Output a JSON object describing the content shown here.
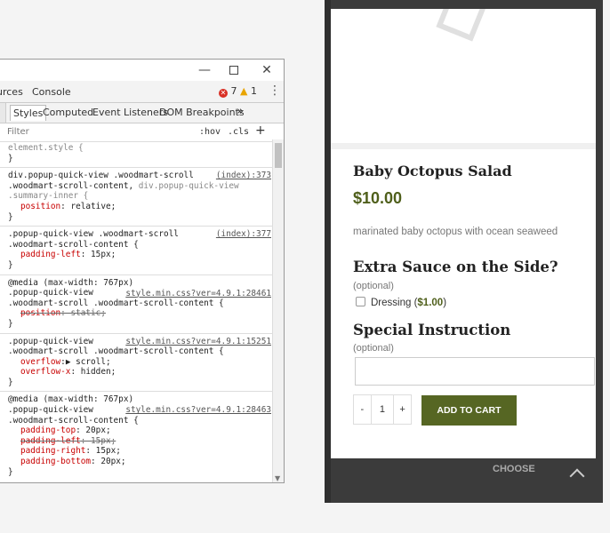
{
  "devtools": {
    "tabs": {
      "sources_partial": "urces",
      "console": "Console"
    },
    "errors": {
      "error_count": "7",
      "warning_count": "1"
    },
    "subtabs": {
      "styles": "Styles",
      "computed": "Computed",
      "event_listeners": "Event Listeners",
      "dom_breakpoints": "DOM Breakpoints",
      "more": "»"
    },
    "filter": {
      "placeholder": "Filter",
      "hov": ":hov",
      "cls": ".cls",
      "add": "+"
    },
    "rules": [
      {
        "sel1": "element.style {",
        "close": "}"
      },
      {
        "sel1": "div.popup-quick-view .woodmart-scroll",
        "sel2": ".woodmart-scroll-content,",
        "sel2b": "div.popup-quick-view",
        "sel3": ".summary-inner {",
        "source": "(index):373",
        "decls": [
          {
            "prop": "position",
            "val": "relative;"
          }
        ],
        "close": "}"
      },
      {
        "sel1": ".popup-quick-view .woodmart-scroll",
        "sel2": ".woodmart-scroll-content {",
        "source": "(index):377",
        "decls": [
          {
            "prop": "padding-left",
            "val": "15px;"
          }
        ],
        "close": "}"
      },
      {
        "media": "@media (max-width: 767px)",
        "sel1": ".popup-quick-view",
        "sel2": ".woodmart-scroll .woodmart-scroll-content {",
        "source": "style.min.css?ver=4.9.1:28461",
        "decls": [
          {
            "prop": "position",
            "val": "static;",
            "struck": true
          }
        ],
        "close": "}"
      },
      {
        "sel1": ".popup-quick-view",
        "sel2": ".woodmart-scroll .woodmart-scroll-content {",
        "source": "style.min.css?ver=4.9.1:15251",
        "decls": [
          {
            "prop": "overflow",
            "val": "▶ scroll;"
          },
          {
            "prop": "overflow-x",
            "val": "hidden;"
          }
        ],
        "close": "}"
      },
      {
        "media": "@media (max-width: 767px)",
        "sel1": ".popup-quick-view",
        "sel2": ".woodmart-scroll",
        "sel3": ".woodmart-scroll-content {",
        "source": "style.min.css?ver=4.9.1:28463",
        "decls": [
          {
            "prop": "padding-top",
            "val": "20px;"
          },
          {
            "prop": "padding-left",
            "val": "15px;",
            "struck": true
          },
          {
            "prop": "padding-right",
            "val": "15px;"
          },
          {
            "prop": "padding-bottom",
            "val": "20px;"
          }
        ],
        "close": "}"
      }
    ]
  },
  "product": {
    "title": "Baby Octopus Salad",
    "price": "$10.00",
    "description": "marinated baby octopus with ocean seaweed",
    "extra_sauce_heading": "Extra Sauce on the Side?",
    "optional_label_1": "(optional)",
    "dressing_label": "Dressing (",
    "dressing_price": "$1.00",
    "dressing_close": ")",
    "special_heading": "Special Instruction",
    "optional_label_2": "(optional)",
    "qty_minus": "-",
    "qty_value": "1",
    "qty_plus": "+",
    "add_to_cart": "ADD TO CART"
  },
  "background": {
    "choose": "CHOOSE"
  },
  "colors": {
    "accent_green": "#566623",
    "price_green": "#4f5f1b"
  }
}
